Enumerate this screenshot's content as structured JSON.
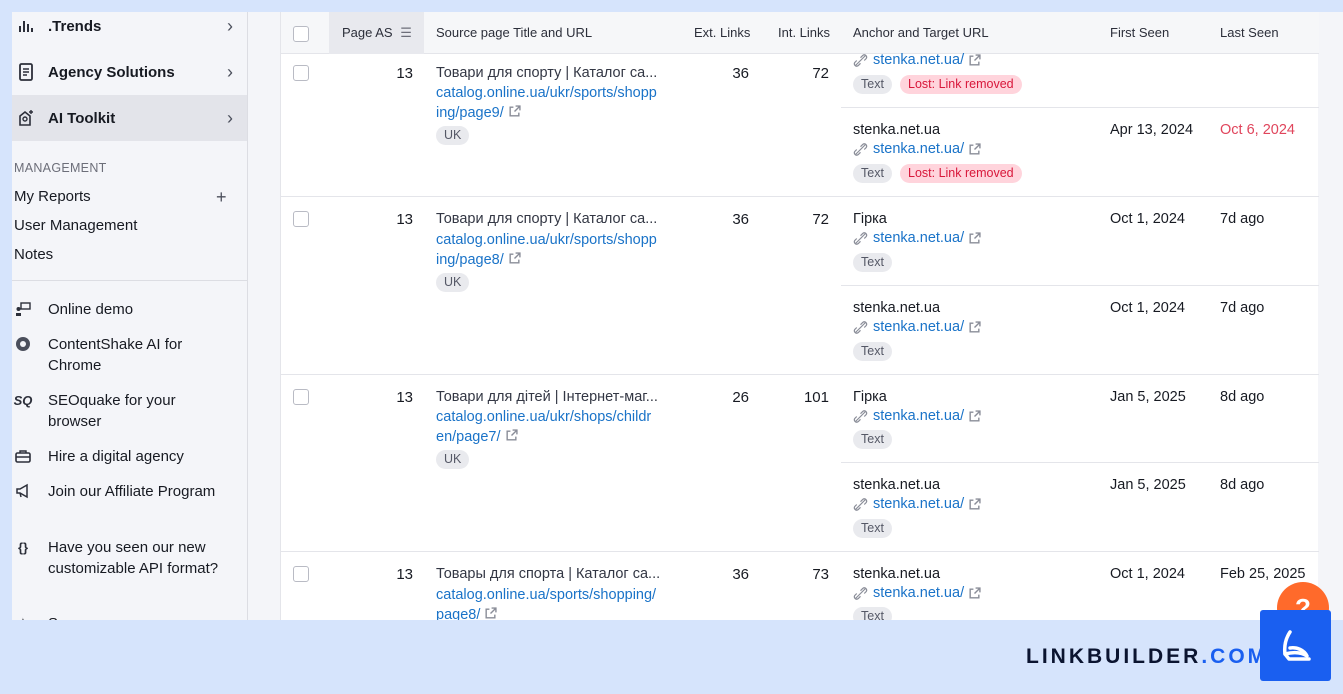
{
  "sidebar": {
    "nav": [
      {
        "label": ".Trends",
        "icon": "bar-chart-icon"
      },
      {
        "label": "Agency Solutions",
        "icon": "document-icon"
      },
      {
        "label": "AI Toolkit",
        "icon": "ai-toolkit-icon"
      }
    ],
    "management_heading": "MANAGEMENT",
    "management": [
      "My Reports",
      "User Management",
      "Notes"
    ],
    "tools": [
      {
        "label": "Online demo",
        "icon": "presenter-icon"
      },
      {
        "label": "ContentShake AI for Chrome",
        "icon": "chrome-icon"
      },
      {
        "label": "SEOquake for your browser",
        "icon": "seoquake-icon",
        "glyph": "SQ"
      },
      {
        "label": "Hire a digital agency",
        "icon": "agency-icon"
      },
      {
        "label": "Join our Affiliate Program",
        "icon": "megaphone-icon"
      },
      {
        "label": "Have you seen our new customizable API format?",
        "icon": "api-braces-icon",
        "glyph": "{}"
      },
      {
        "label": "S",
        "icon": "star-icon"
      }
    ]
  },
  "table": {
    "headers": {
      "page_as": "Page AS",
      "source": "Source page Title and URL",
      "ext_links": "Ext. Links",
      "int_links": "Int. Links",
      "anchor": "Anchor and Target URL",
      "first_seen": "First Seen",
      "last_seen": "Last Seen"
    },
    "rows": [
      {
        "as": "13",
        "title": "Товари для спорту | Каталог са...",
        "url_line1": "catalog.online.ua/ukr/sports/shopp",
        "url_line2": "ing/page9/",
        "lang": "UK",
        "ext": "36",
        "int": "72"
      },
      {
        "as": "13",
        "title": "Товари для спорту | Каталог са...",
        "url_line1": "catalog.online.ua/ukr/sports/shopp",
        "url_line2": "ing/page8/",
        "lang": "UK",
        "ext": "36",
        "int": "72"
      },
      {
        "as": "13",
        "title": "Товари для дітей | Інтернет-маг...",
        "url_line1": "catalog.online.ua/ukr/shops/childr",
        "url_line2": "en/page7/",
        "lang": "UK",
        "ext": "26",
        "int": "101"
      },
      {
        "as": "13",
        "title": "Товары для спорта | Каталог са...",
        "url_line1": "catalog.online.ua/sports/shopping/",
        "url_line2": "page8/",
        "lang": "",
        "ext": "36",
        "int": "73"
      }
    ],
    "links": [
      {
        "anchor": "",
        "target": "stenka.net.ua/",
        "type": "Text",
        "status": "Lost: Link removed",
        "first": "",
        "last": ""
      },
      {
        "anchor": "stenka.net.ua",
        "target": "stenka.net.ua/",
        "type": "Text",
        "status": "Lost: Link removed",
        "first": "Apr 13, 2024",
        "last": "Oct 6, 2024"
      },
      {
        "anchor": "Гірка",
        "target": "stenka.net.ua/",
        "type": "Text",
        "status": "",
        "first": "Oct 1, 2024",
        "last": "7d ago"
      },
      {
        "anchor": "stenka.net.ua",
        "target": "stenka.net.ua/",
        "type": "Text",
        "status": "",
        "first": "Oct 1, 2024",
        "last": "7d ago"
      },
      {
        "anchor": "Гірка",
        "target": "stenka.net.ua/",
        "type": "Text",
        "status": "",
        "first": "Jan 5, 2025",
        "last": "8d ago"
      },
      {
        "anchor": "stenka.net.ua",
        "target": "stenka.net.ua/",
        "type": "Text",
        "status": "",
        "first": "Jan 5, 2025",
        "last": "8d ago"
      },
      {
        "anchor": "stenka.net.ua",
        "target": "stenka.net.ua/",
        "type": "Text",
        "status": "",
        "first": "Oct 1, 2024",
        "last": "Feb 25, 2025"
      }
    ]
  },
  "help_label": "?",
  "brand": {
    "name": "LINKBUILDER",
    "dot": ".",
    "tld": "COM"
  },
  "colors": {
    "accent": "#1a5ff0",
    "link": "#1a73c8",
    "lost": "#d8173a",
    "help": "#ff6a2b"
  }
}
